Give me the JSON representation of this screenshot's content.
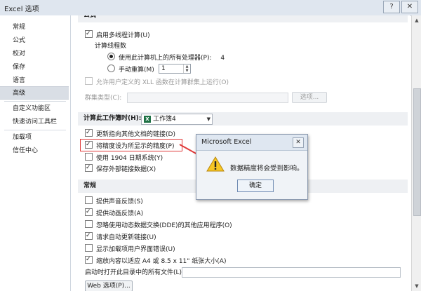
{
  "window": {
    "title": "Excel 选项",
    "help_btn": "?",
    "close_btn": "✕"
  },
  "sidebar": {
    "items": [
      {
        "label": "常规"
      },
      {
        "label": "公式"
      },
      {
        "label": "校对"
      },
      {
        "label": "保存"
      },
      {
        "label": "语言"
      },
      {
        "label": "高级",
        "active": true
      },
      {
        "label": "自定义功能区"
      },
      {
        "label": "快速访问工具栏"
      },
      {
        "label": "加载项"
      },
      {
        "label": "信任中心"
      }
    ]
  },
  "formulas": {
    "header_partial": "公式",
    "multithread": "启用多线程计算(U)",
    "thread_count_label": "计算线程数",
    "use_all_processors": "使用此计算机上的所有处理器(P):",
    "processor_count": "4",
    "manual_threads": "手动重算(M)",
    "manual_value": "1",
    "allow_xll": "允许用户定义的 XLL 函数在计算群集上运行(O)",
    "cluster_type_label": "群集类型(C):",
    "options_btn": "选项..."
  },
  "calc_workbook": {
    "header": "计算此工作簿时(H):",
    "workbook_name": "工作簿4",
    "items": [
      {
        "label": "更新指向其他文档的链接(D)",
        "checked": true
      },
      {
        "label": "将精度设为所显示的精度(P)",
        "checked": true
      },
      {
        "label": "使用 1904 日期系统(Y)",
        "checked": false
      },
      {
        "label": "保存外部链接数据(X)",
        "checked": true
      }
    ]
  },
  "general": {
    "header": "常规",
    "items": [
      {
        "label": "提供声音反馈(S)",
        "checked": false
      },
      {
        "label": "提供动画反馈(A)",
        "checked": true
      },
      {
        "label": "忽略使用动态数据交换(DDE)的其他应用程序(O)",
        "checked": false
      },
      {
        "label": "请求自动更新链接(U)",
        "checked": true
      },
      {
        "label": "显示加载项用户界面错误(U)",
        "checked": false
      },
      {
        "label": "缩放内容以适应 A4 或 8.5 x 11\" 纸张大小(A)",
        "checked": true
      }
    ],
    "startup_label": "启动时打开此目录中的所有文件(L):",
    "web_options_btn": "Web 选项(P)..."
  },
  "dialog": {
    "title": "Microsoft Excel",
    "close": "✕",
    "message": "数据精度将会受到影响。",
    "ok": "确定"
  },
  "colors": {
    "highlight": "#e03a3a",
    "excel_green": "#1e7145",
    "warning_yellow": "#f6c624"
  },
  "icons": {
    "warning": "warning-icon",
    "workbook": "excel-workbook-icon"
  }
}
